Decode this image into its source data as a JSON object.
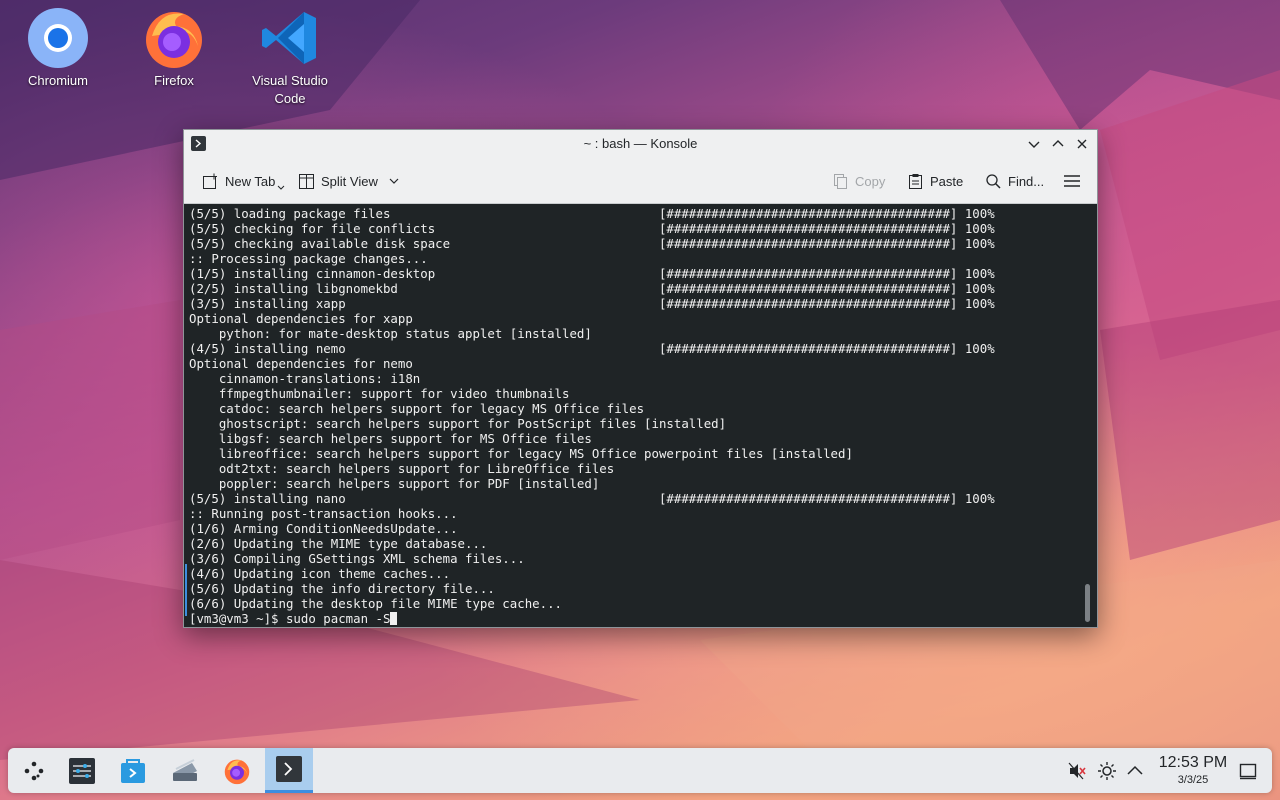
{
  "desktop": {
    "icons": [
      {
        "label": "Chromium"
      },
      {
        "label": "Firefox"
      },
      {
        "label": "Visual Studio Code"
      }
    ]
  },
  "window": {
    "title": "~ : bash — Konsole",
    "toolbar": {
      "new_tab": "New Tab",
      "split_view": "Split View",
      "copy": "Copy",
      "paste": "Paste",
      "find": "Find..."
    }
  },
  "terminal": {
    "lines": [
      "(5/5) loading package files                                    [######################################] 100%",
      "(5/5) checking for file conflicts                              [######################################] 100%",
      "(5/5) checking available disk space                            [######################################] 100%",
      ":: Processing package changes...",
      "(1/5) installing cinnamon-desktop                              [######################################] 100%",
      "(2/5) installing libgnomekbd                                   [######################################] 100%",
      "(3/5) installing xapp                                          [######################################] 100%",
      "Optional dependencies for xapp",
      "    python: for mate-desktop status applet [installed]",
      "(4/5) installing nemo                                          [######################################] 100%",
      "Optional dependencies for nemo",
      "    cinnamon-translations: i18n",
      "    ffmpegthumbnailer: support for video thumbnails",
      "    catdoc: search helpers support for legacy MS Office files",
      "    ghostscript: search helpers support for PostScript files [installed]",
      "    libgsf: search helpers support for MS Office files",
      "    libreoffice: search helpers support for legacy MS Office powerpoint files [installed]",
      "    odt2txt: search helpers support for LibreOffice files",
      "    poppler: search helpers support for PDF [installed]",
      "(5/5) installing nano                                          [######################################] 100%",
      ":: Running post-transaction hooks...",
      "(1/6) Arming ConditionNeedsUpdate...",
      "(2/6) Updating the MIME type database...",
      "(3/6) Compiling GSettings XML schema files...",
      "(4/6) Updating icon theme caches...",
      "(5/6) Updating the info directory file...",
      "(6/6) Updating the desktop file MIME type cache..."
    ],
    "prompt": "[vm3@vm3 ~]$ sudo pacman -S"
  },
  "taskbar": {
    "clock_time": "12:53 PM",
    "clock_date": "3/3/25"
  },
  "colors": {
    "accent": "#3d8ee0",
    "terminal_bg": "#1f2426",
    "terminal_fg": "#f0f0f0"
  }
}
